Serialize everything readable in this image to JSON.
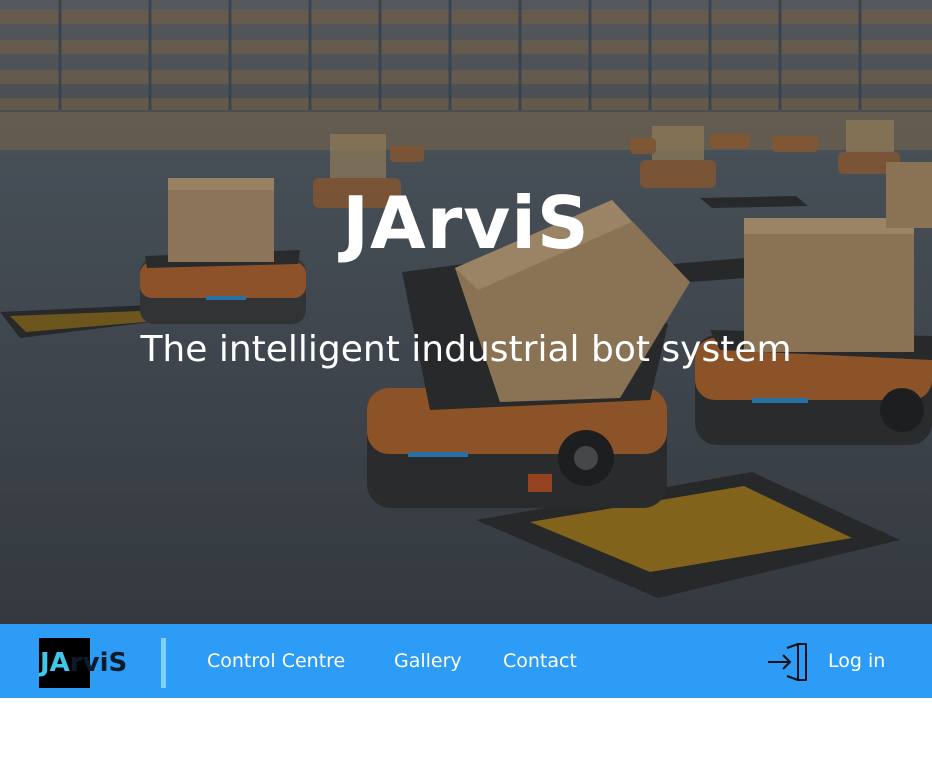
{
  "hero": {
    "title": "JArviS",
    "subtitle": "The intelligent industrial bot system",
    "background_image": "warehouse-robots-carrying-boxes"
  },
  "navbar": {
    "background_color": "#2c9cf6",
    "logo": {
      "prefix": "JA",
      "suffix": "rviS",
      "prefix_color": "#3fc6e8",
      "accent_bar_color": "#7fd3f2"
    },
    "links": [
      {
        "label": "Control Centre"
      },
      {
        "label": "Gallery"
      },
      {
        "label": "Contact"
      }
    ],
    "login": {
      "label": "Log in",
      "icon": "login-door-icon"
    }
  }
}
